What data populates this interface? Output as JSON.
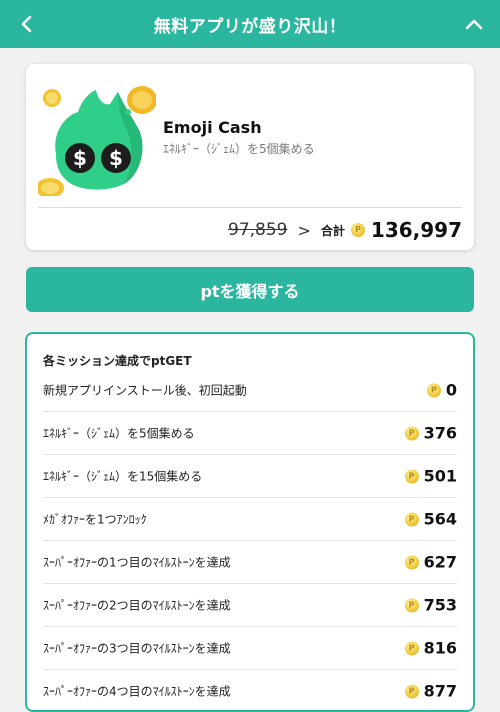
{
  "header": {
    "title": "無料アプリが盛り沢山！",
    "back_icon": "chevron-left-icon",
    "collapse_icon": "chevron-up-icon"
  },
  "app": {
    "name": "Emoji Cash",
    "description": "ｴﾈﾙｷﾞｰ（ｼﾞｪﾑ）を5個集める",
    "old_points": "97,859",
    "arrow": ">",
    "total_label": "合計",
    "total_points": "136,997"
  },
  "cta": {
    "label": "ptを獲得する"
  },
  "missions": {
    "title": "各ミッション達成でptGET",
    "items": [
      {
        "label": "新規アプリインストール後、初回起動",
        "points": "0"
      },
      {
        "label": "ｴﾈﾙｷﾞｰ（ｼﾞｪﾑ）を5個集める",
        "points": "376"
      },
      {
        "label": "ｴﾈﾙｷﾞｰ（ｼﾞｪﾑ）を15個集める",
        "points": "501"
      },
      {
        "label": "ﾒｶﾞｵﾌｧｰを1つｱﾝﾛｯｸ",
        "points": "564"
      },
      {
        "label": "ｽｰﾊﾟｰｵﾌｧｰの1つ目のﾏｲﾙｽﾄｰﾝを達成",
        "points": "627"
      },
      {
        "label": "ｽｰﾊﾟｰｵﾌｧｰの2つ目のﾏｲﾙｽﾄｰﾝを達成",
        "points": "753"
      },
      {
        "label": "ｽｰﾊﾟｰｵﾌｧｰの3つ目のﾏｲﾙｽﾄｰﾝを達成",
        "points": "816"
      },
      {
        "label": "ｽｰﾊﾟｰｵﾌｧｰの4つ目のﾏｲﾙｽﾄｰﾝを達成",
        "points": "877"
      }
    ]
  },
  "colors": {
    "accent": "#2bb79f",
    "coin": "#f3d34a"
  }
}
